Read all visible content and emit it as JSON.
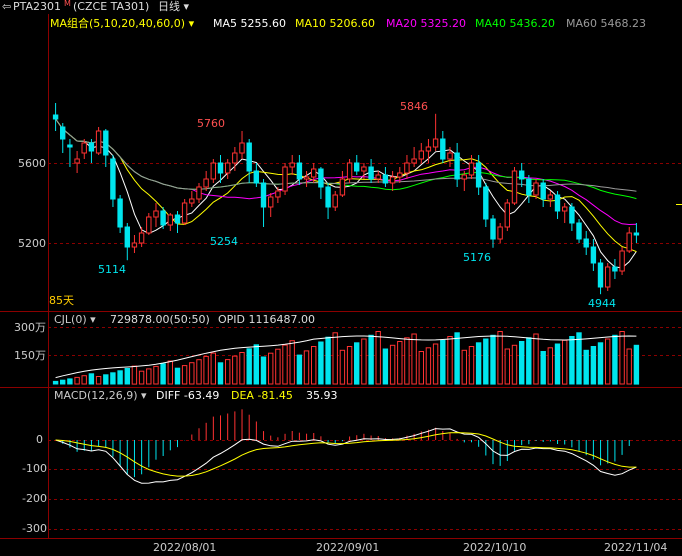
{
  "header": {
    "back_icon": "back-arrow-icon",
    "symbol": "PTA2301",
    "symbol_sup": "M",
    "contract": "(CZCE TA301)",
    "period": "日线",
    "period_icon": "chevron-down-icon"
  },
  "ma_bar": {
    "label": "MA组合(5,10,20,40,60,0)",
    "items": [
      {
        "text": "MA5 5255.60",
        "color": "#ffffff"
      },
      {
        "text": "MA10 5206.60",
        "color": "#ffff00"
      },
      {
        "text": "MA20 5325.20",
        "color": "#ff00ff"
      },
      {
        "text": "MA40 5436.20",
        "color": "#00ff00"
      },
      {
        "text": "MA60 5468.23",
        "color": "#9a9a9a"
      }
    ]
  },
  "price_axis": {
    "ticks": [
      "5600",
      "5200"
    ]
  },
  "price_annotations": [
    "5760",
    "5846",
    "5254",
    "5114",
    "5176",
    "4944"
  ],
  "days_label": "85天",
  "volume_bar": {
    "label": "CJL(0)",
    "value": "729878.00(50:50)",
    "opid": "OPID 1116487.00",
    "ticks": [
      "300万",
      "150万"
    ]
  },
  "macd_bar": {
    "label": "MACD(12,26,9)",
    "diff": "DIFF -63.49",
    "dea": "DEA -81.45",
    "macd": "35.93",
    "ticks": [
      "0",
      "-100",
      "-200",
      "-300"
    ]
  },
  "date_axis": [
    "2022/08/01",
    "2022/09/01",
    "2022/10/10",
    "2022/11/04"
  ],
  "colors": {
    "up": "#ff3232",
    "down": "#00e5ee",
    "grid": "#8b0000"
  },
  "chart_data": {
    "type": "candlestick",
    "price_ylim": [
      4900,
      6000
    ],
    "candles": [
      [
        5840,
        5900,
        5820,
        5760
      ],
      [
        5780,
        5800,
        5720,
        5650
      ],
      [
        5690,
        5720,
        5680,
        5580
      ],
      [
        5600,
        5660,
        5620,
        5550
      ],
      [
        5650,
        5720,
        5700,
        5620
      ],
      [
        5700,
        5720,
        5660,
        5600
      ],
      [
        5650,
        5780,
        5760,
        5640
      ],
      [
        5760,
        5770,
        5640,
        5580
      ],
      [
        5620,
        5640,
        5420,
        5380
      ],
      [
        5420,
        5440,
        5280,
        5250
      ],
      [
        5280,
        5300,
        5180,
        5114
      ],
      [
        5180,
        5240,
        5200,
        5150
      ],
      [
        5200,
        5280,
        5250,
        5180
      ],
      [
        5250,
        5350,
        5330,
        5240
      ],
      [
        5330,
        5400,
        5360,
        5280
      ],
      [
        5360,
        5380,
        5290,
        5270
      ],
      [
        5290,
        5350,
        5340,
        5260
      ],
      [
        5340,
        5360,
        5300,
        5250
      ],
      [
        5300,
        5420,
        5400,
        5290
      ],
      [
        5400,
        5460,
        5420,
        5380
      ],
      [
        5420,
        5500,
        5480,
        5400
      ],
      [
        5480,
        5560,
        5520,
        5460
      ],
      [
        5520,
        5620,
        5600,
        5500
      ],
      [
        5600,
        5640,
        5550,
        5500
      ],
      [
        5550,
        5620,
        5600,
        5520
      ],
      [
        5600,
        5680,
        5650,
        5560
      ],
      [
        5650,
        5760,
        5700,
        5620
      ],
      [
        5700,
        5720,
        5560,
        5500
      ],
      [
        5560,
        5600,
        5500,
        5480
      ],
      [
        5500,
        5520,
        5380,
        5280
      ],
      [
        5380,
        5450,
        5430,
        5330
      ],
      [
        5430,
        5480,
        5460,
        5400
      ],
      [
        5460,
        5600,
        5580,
        5440
      ],
      [
        5580,
        5640,
        5600,
        5540
      ],
      [
        5600,
        5640,
        5520,
        5490
      ],
      [
        5520,
        5560,
        5530,
        5480
      ],
      [
        5530,
        5600,
        5570,
        5500
      ],
      [
        5570,
        5580,
        5480,
        5420
      ],
      [
        5480,
        5500,
        5380,
        5320
      ],
      [
        5380,
        5460,
        5440,
        5360
      ],
      [
        5440,
        5560,
        5520,
        5430
      ],
      [
        5520,
        5620,
        5600,
        5500
      ],
      [
        5600,
        5640,
        5560,
        5540
      ],
      [
        5560,
        5600,
        5580,
        5520
      ],
      [
        5580,
        5620,
        5520,
        5500
      ],
      [
        5520,
        5560,
        5540,
        5500
      ],
      [
        5540,
        5580,
        5500,
        5480
      ],
      [
        5500,
        5560,
        5530,
        5460
      ],
      [
        5530,
        5580,
        5550,
        5500
      ],
      [
        5550,
        5640,
        5600,
        5520
      ],
      [
        5600,
        5680,
        5620,
        5580
      ],
      [
        5620,
        5700,
        5660,
        5600
      ],
      [
        5660,
        5720,
        5680,
        5600
      ],
      [
        5680,
        5846,
        5720,
        5660
      ],
      [
        5720,
        5760,
        5620,
        5600
      ],
      [
        5620,
        5680,
        5650,
        5580
      ],
      [
        5650,
        5700,
        5520,
        5480
      ],
      [
        5520,
        5560,
        5540,
        5460
      ],
      [
        5540,
        5640,
        5600,
        5520
      ],
      [
        5600,
        5640,
        5480,
        5440
      ],
      [
        5480,
        5500,
        5320,
        5280
      ],
      [
        5320,
        5340,
        5220,
        5176
      ],
      [
        5220,
        5300,
        5280,
        5200
      ],
      [
        5280,
        5420,
        5400,
        5260
      ],
      [
        5400,
        5580,
        5560,
        5390
      ],
      [
        5560,
        5600,
        5520,
        5480
      ],
      [
        5520,
        5540,
        5440,
        5400
      ],
      [
        5440,
        5520,
        5500,
        5420
      ],
      [
        5500,
        5520,
        5420,
        5380
      ],
      [
        5420,
        5460,
        5440,
        5380
      ],
      [
        5440,
        5460,
        5360,
        5320
      ],
      [
        5360,
        5400,
        5380,
        5300
      ],
      [
        5380,
        5400,
        5300,
        5260
      ],
      [
        5300,
        5320,
        5220,
        5200
      ],
      [
        5220,
        5260,
        5180,
        5140
      ],
      [
        5180,
        5220,
        5100,
        5060
      ],
      [
        5100,
        5120,
        4980,
        4944
      ],
      [
        4980,
        5100,
        5080,
        4960
      ],
      [
        5080,
        5120,
        5060,
        5020
      ],
      [
        5060,
        5180,
        5160,
        5040
      ],
      [
        5160,
        5280,
        5250,
        5150
      ],
      [
        5250,
        5300,
        5240,
        5200
      ]
    ]
  }
}
